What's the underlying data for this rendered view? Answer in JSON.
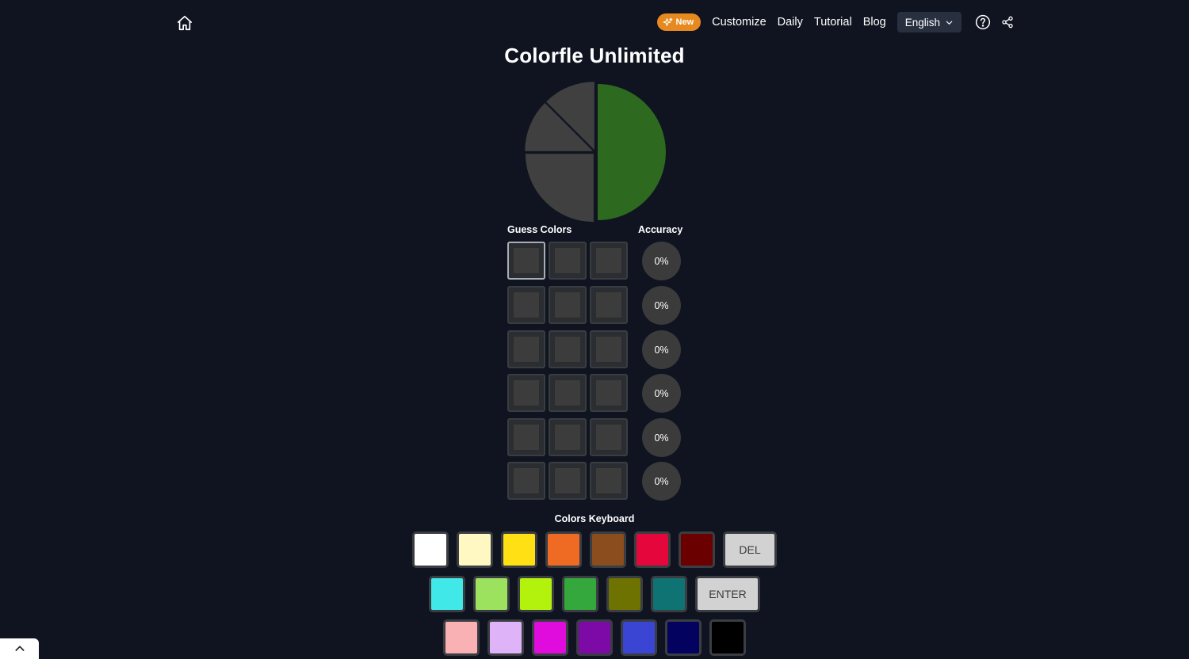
{
  "nav": {
    "home_icon": "home-icon",
    "badge_icon": "sparkle-icon",
    "badge_label": "New",
    "links": [
      {
        "label": "Customize"
      },
      {
        "label": "Daily"
      },
      {
        "label": "Tutorial"
      },
      {
        "label": "Blog"
      }
    ],
    "language": "English",
    "language_icon": "chevron-down-icon",
    "help_icon": "help-circle-icon",
    "share_icon": "share-icon"
  },
  "title": "Colorfle Unlimited",
  "target_pie": {
    "slices": [
      {
        "color": "#2d6a1f",
        "fraction": 0.5
      },
      {
        "color": "#404040",
        "fraction": 0.25
      },
      {
        "color": "#404040",
        "fraction": 0.125
      },
      {
        "color": "#404040",
        "fraction": 0.125
      }
    ]
  },
  "board": {
    "guess_label": "Guess Colors",
    "accuracy_label": "Accuracy",
    "rows": [
      {
        "accuracy": "0%"
      },
      {
        "accuracy": "0%"
      },
      {
        "accuracy": "0%"
      },
      {
        "accuracy": "0%"
      },
      {
        "accuracy": "0%"
      },
      {
        "accuracy": "0%"
      }
    ]
  },
  "keyboard": {
    "label": "Colors Keyboard",
    "row1": [
      "#ffffff",
      "#fff8c2",
      "#ffe014",
      "#ef6a22",
      "#8b4c1e",
      "#e5073c",
      "#6a0000"
    ],
    "row2": [
      "#40e8e8",
      "#9de25e",
      "#b2f20c",
      "#34a83c",
      "#6e7200",
      "#0f7373"
    ],
    "row3": [
      "#f9b1b4",
      "#dfb3f8",
      "#e00bdd",
      "#7d0aa7",
      "#3b45d4",
      "#04025f",
      "#000000"
    ],
    "del_label": "DEL",
    "enter_label": "ENTER"
  },
  "scroll_icon": "chevron-up-icon",
  "colors": {
    "background": "#0f1420",
    "badge": "#e68a1f",
    "cell": "#3c3c3c",
    "accuracy_bg": "#3b3b3b"
  }
}
